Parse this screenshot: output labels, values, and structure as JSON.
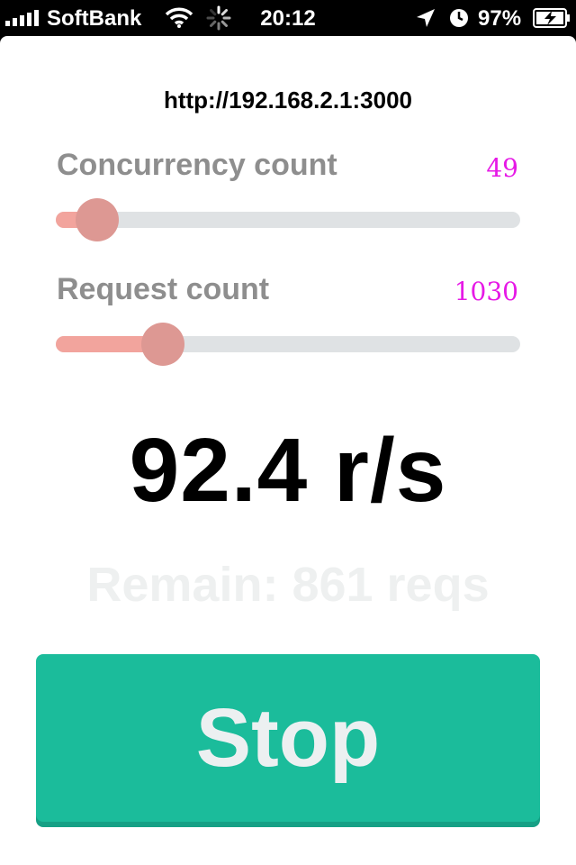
{
  "status_bar": {
    "carrier": "SoftBank",
    "time": "20:12",
    "battery_percent": "97%",
    "icons": [
      "signal-bars-icon",
      "wifi-icon",
      "activity-spinner-icon",
      "location-arrow-icon",
      "alarm-clock-icon",
      "battery-charging-icon"
    ]
  },
  "target": {
    "url": "http://192.168.2.1:3000"
  },
  "concurrency": {
    "label": "Concurrency count",
    "value": "49",
    "level": 0.09
  },
  "requests": {
    "label": "Request count",
    "value": "1030",
    "level": 0.23
  },
  "result": {
    "rate": "92.4 r/s",
    "remain": "Remain: 861 reqs"
  },
  "actions": {
    "stop_label": "Stop"
  },
  "colors": {
    "accent_green": "#1bbc9b",
    "value_magenta": "#e619e6",
    "slider_fill": "#f2a49d",
    "slider_thumb": "#dd9893"
  }
}
